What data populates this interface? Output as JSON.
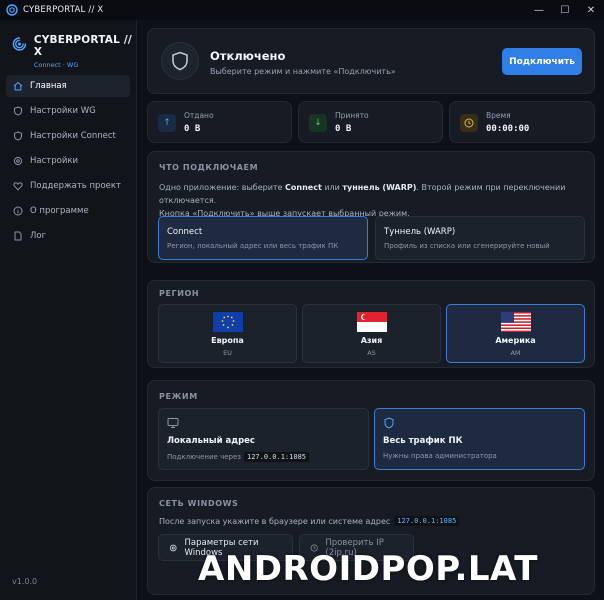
{
  "window": {
    "title": "CYBERPORTAL // X",
    "minimize": "—",
    "maximize": "☐",
    "close": "✕"
  },
  "sidebar": {
    "brand_title": "CYBERPORTAL // X",
    "brand_sub": "Connect · WG",
    "items": [
      {
        "label": "Главная",
        "icon": "home-icon"
      },
      {
        "label": "Настройки WG",
        "icon": "shield-icon"
      },
      {
        "label": "Настройки Connect",
        "icon": "shield-icon"
      },
      {
        "label": "Настройки",
        "icon": "gear-icon"
      },
      {
        "label": "Поддержать проект",
        "icon": "heart-icon"
      },
      {
        "label": "О программе",
        "icon": "info-icon"
      },
      {
        "label": "Лог",
        "icon": "document-icon"
      }
    ],
    "version": "v1.0.0"
  },
  "status": {
    "title": "Отключено",
    "subtitle": "Выберите режим и нажмите «Подключить»",
    "connect_button": "Подключить"
  },
  "stats": [
    {
      "label": "Отдано",
      "value": "0 B",
      "icon": "arrow-up-icon",
      "color": "#4fa6ff"
    },
    {
      "label": "Принято",
      "value": "0 B",
      "icon": "arrow-down-icon",
      "color": "#4fd07a"
    },
    {
      "label": "Время",
      "value": "00:00:00",
      "icon": "clock-icon",
      "color": "#e0b347"
    }
  ],
  "what": {
    "heading": "ЧТО ПОДКЛЮЧАЕМ",
    "desc_part1": "Одно приложение: выберите ",
    "desc_b1": "Connect",
    "desc_part2": " или ",
    "desc_b2": "туннель (WARP)",
    "desc_part3": ". Второй режим при переключении отключается.",
    "desc_line2": "Кнопка «Подключить» выше запускает выбранный режим.",
    "options": [
      {
        "title": "Connect",
        "subtitle": "Регион, локальный адрес или весь трафик ПК",
        "selected": true
      },
      {
        "title": "Туннель (WARP)",
        "subtitle": "Профиль из списка или сгенерируйте новый",
        "selected": false
      }
    ]
  },
  "region": {
    "heading": "РЕГИОН",
    "items": [
      {
        "name": "Европа",
        "code": "EU",
        "selected": false
      },
      {
        "name": "Азия",
        "code": "AS",
        "selected": false
      },
      {
        "name": "Америка",
        "code": "AM",
        "selected": true
      }
    ]
  },
  "mode": {
    "heading": "РЕЖИМ",
    "items": [
      {
        "title": "Локальный адрес",
        "sub_prefix": "Подключение через",
        "sub_code": "127.0.0.1:1085",
        "icon": "monitor-icon",
        "selected": false
      },
      {
        "title": "Весь трафик ПК",
        "sub_prefix": "Нужны права администратора",
        "sub_code": "",
        "icon": "shield-icon",
        "selected": true
      }
    ]
  },
  "windows": {
    "heading": "СЕТЬ WINDOWS",
    "desc": "После запуска укажите в браузере или системе адрес",
    "address": "127.0.0.1:1085",
    "button1": "Параметры сети Windows",
    "button2": "Проверить IP (2ip.ru)"
  },
  "watermark": "ANDROIDPOP.LAT",
  "colors": {
    "accent": "#2f7fe6",
    "background": "#0d1017",
    "card": "#161b24",
    "selected_border": "#3f7cd6"
  }
}
